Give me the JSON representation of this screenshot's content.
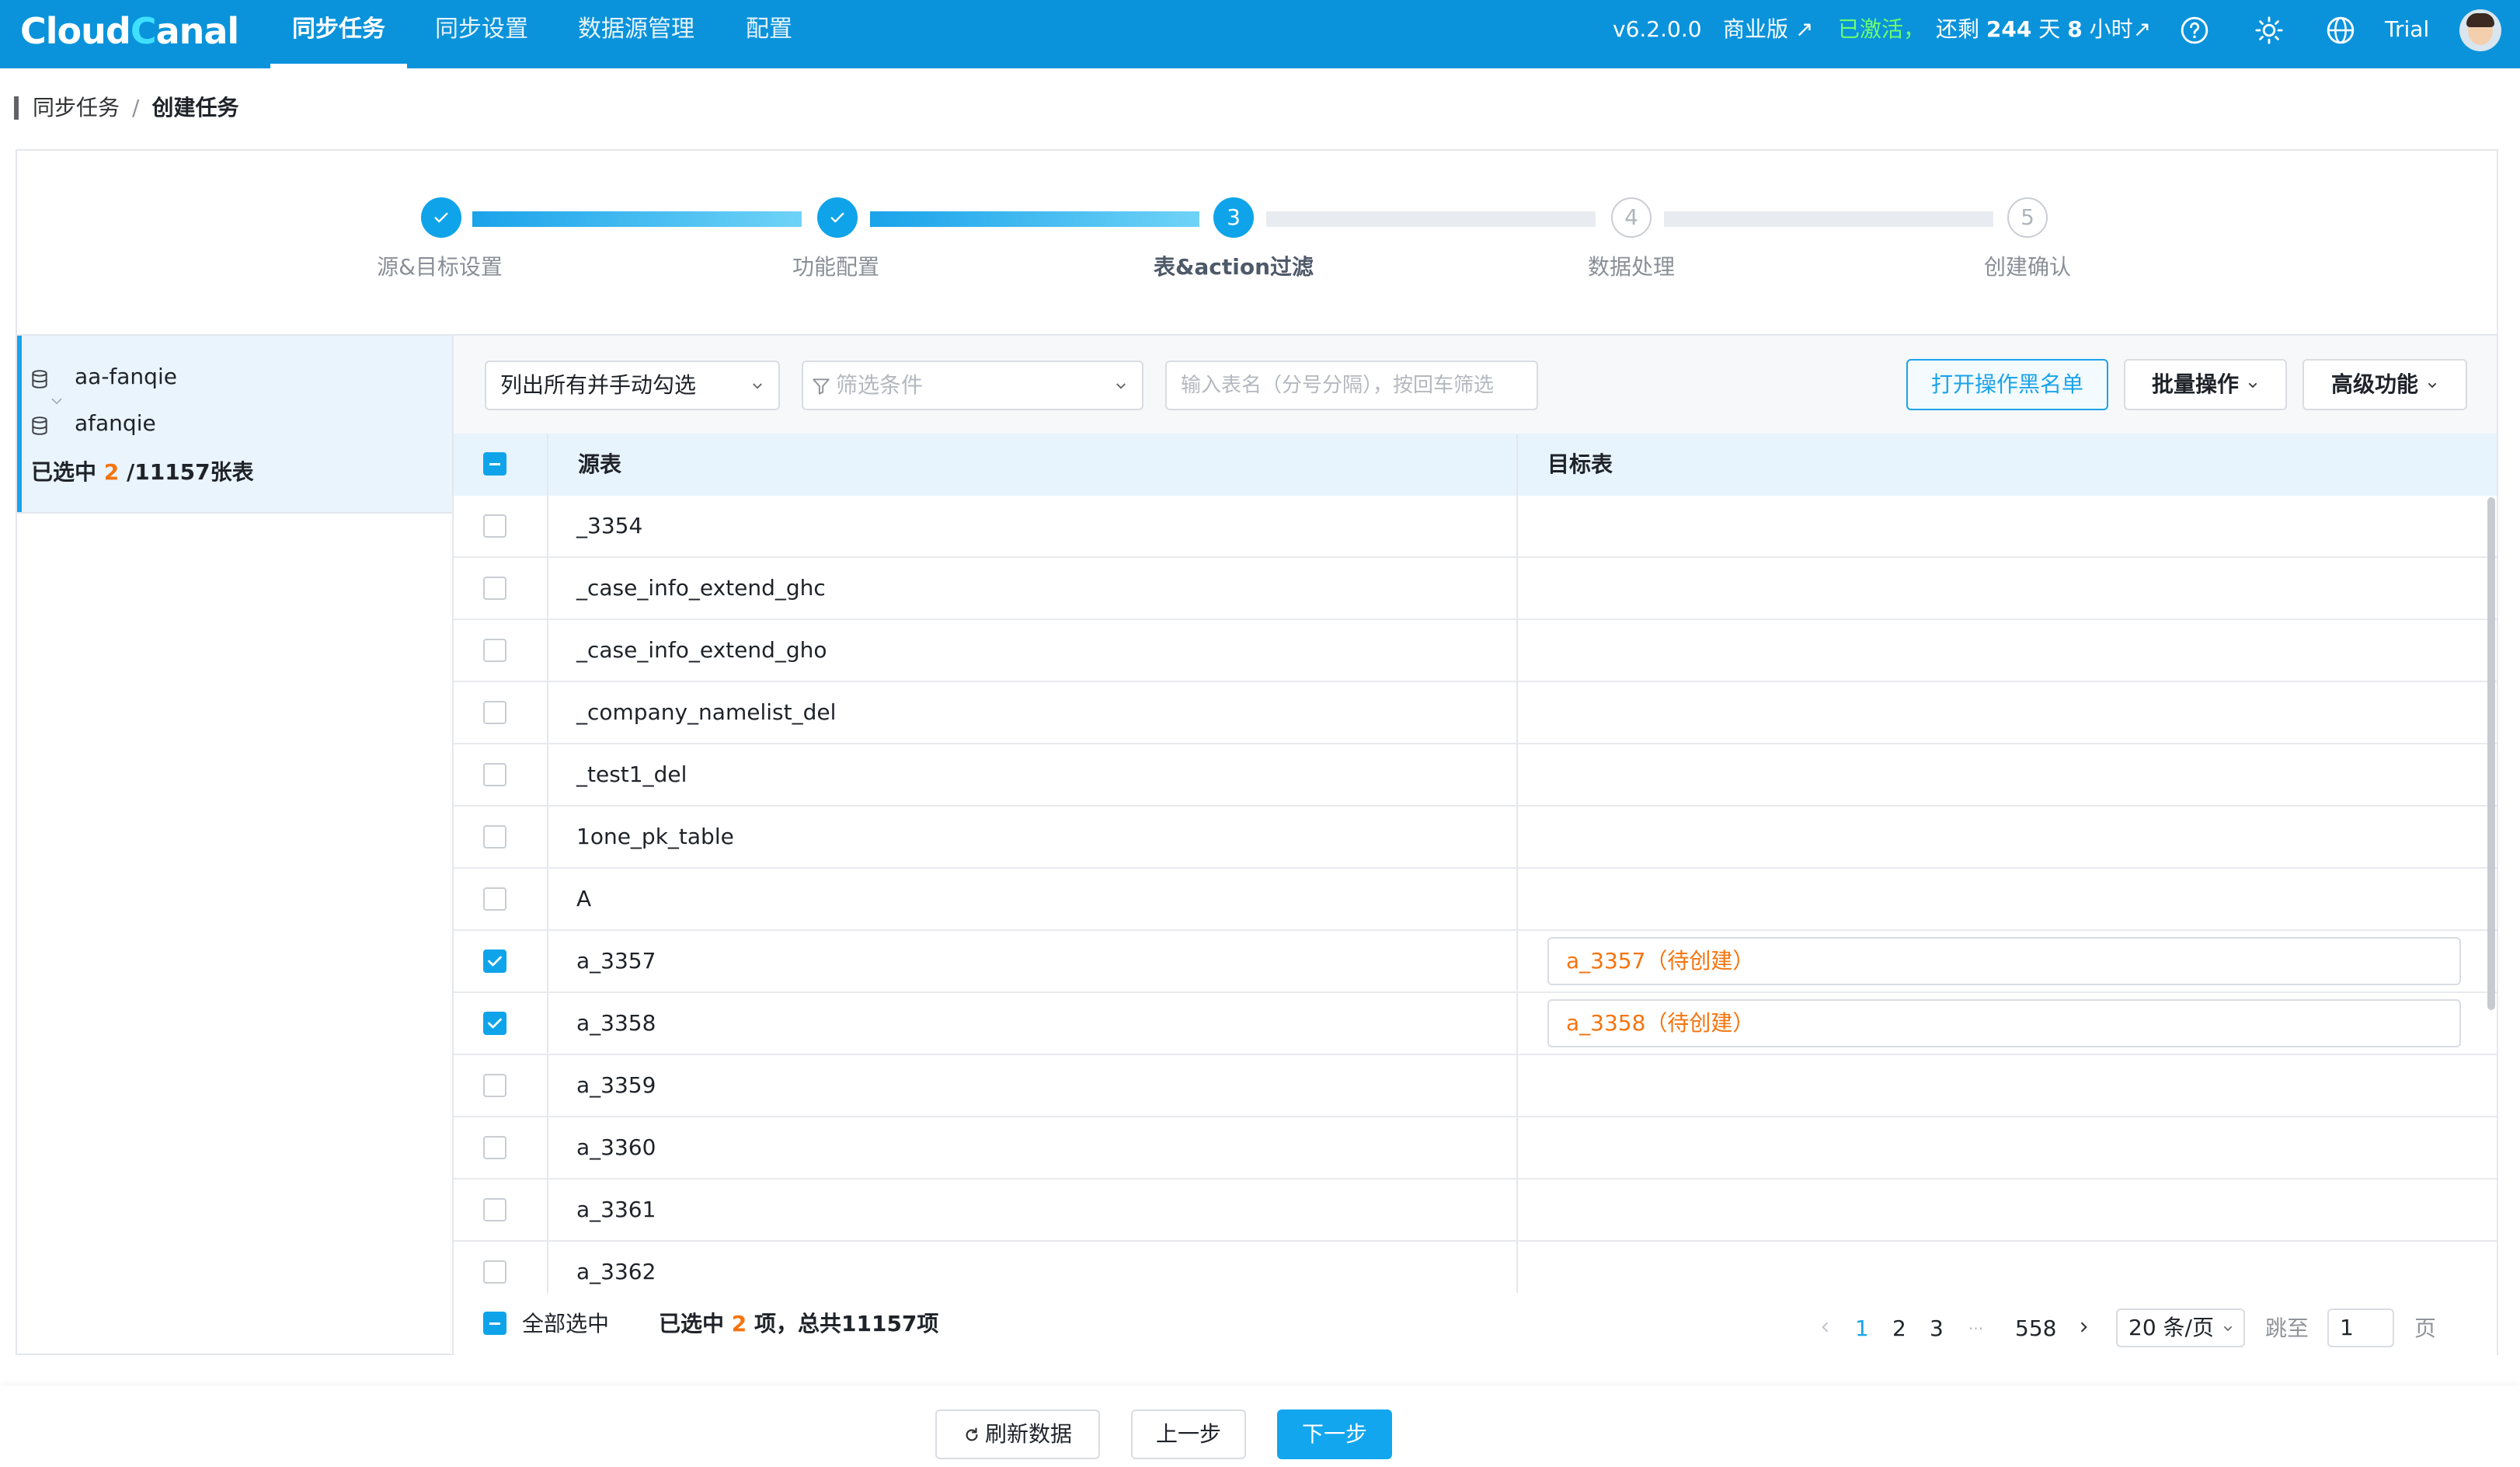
{
  "header": {
    "logo": "CloudCanal",
    "nav": [
      "同步任务",
      "同步设置",
      "数据源管理",
      "配置"
    ],
    "active_nav": "同步任务",
    "version": "v6.2.0.0",
    "edition": "商业版 ↗",
    "activated": "已激活，",
    "remaining_prefix": "还剩",
    "remaining_days": "244",
    "days_unit": "天",
    "remaining_hours": "8",
    "hours_unit": "小时↗",
    "user": "Trial",
    "accent_color": "#0a93db"
  },
  "breadcrumb": {
    "parent": "同步任务",
    "separator": "/",
    "current": "创建任务"
  },
  "steps": [
    {
      "num": "1",
      "label": "源&目标设置",
      "state": "done"
    },
    {
      "num": "2",
      "label": "功能配置",
      "state": "done"
    },
    {
      "num": "3",
      "label": "表&action过滤",
      "state": "current"
    },
    {
      "num": "4",
      "label": "数据处理",
      "state": "todo"
    },
    {
      "num": "5",
      "label": "创建确认",
      "state": "todo"
    }
  ],
  "left_panel": {
    "source_db": "aa-fanqie",
    "target_db": "afanqie",
    "selected_prefix": "已选中",
    "selected_count": "2",
    "selected_suffix": "/11157张表"
  },
  "toolbar": {
    "mode_select": "列出所有并手动勾选",
    "filter_placeholder": "筛选条件",
    "table_input_placeholder": "输入表名（分号分隔），按回车筛选",
    "blacklist_button": "打开操作黑名单",
    "batch_button": "批量操作",
    "advanced_button": "高级功能"
  },
  "table": {
    "columns": [
      "源表",
      "目标表"
    ],
    "rows": [
      {
        "source": "_3354",
        "checked": false,
        "target": ""
      },
      {
        "source": "_case_info_extend_ghc",
        "checked": false,
        "target": ""
      },
      {
        "source": "_case_info_extend_gho",
        "checked": false,
        "target": ""
      },
      {
        "source": "_company_namelist_del",
        "checked": false,
        "target": ""
      },
      {
        "source": "_test1_del",
        "checked": false,
        "target": ""
      },
      {
        "source": "1one_pk_table",
        "checked": false,
        "target": ""
      },
      {
        "source": "A",
        "checked": false,
        "target": ""
      },
      {
        "source": "a_3357",
        "checked": true,
        "target": "a_3357（待创建）"
      },
      {
        "source": "a_3358",
        "checked": true,
        "target": "a_3358（待创建）"
      },
      {
        "source": "a_3359",
        "checked": false,
        "target": ""
      },
      {
        "source": "a_3360",
        "checked": false,
        "target": ""
      },
      {
        "source": "a_3361",
        "checked": false,
        "target": ""
      },
      {
        "source": "a_3362",
        "checked": false,
        "target": ""
      }
    ]
  },
  "footer": {
    "select_all": "全部选中",
    "selected_prefix": "已选中",
    "selected_count": "2",
    "selected_suffix": "项，总共11157项",
    "pages": [
      "1",
      "2",
      "3"
    ],
    "ellipsis": "···",
    "last_page": "558",
    "page_size": "20 条/页",
    "jump_label": "跳至",
    "jump_value": "1",
    "page_unit": "页"
  },
  "bottom": {
    "refresh": "刷新数据",
    "prev": "上一步",
    "next": "下一步"
  }
}
